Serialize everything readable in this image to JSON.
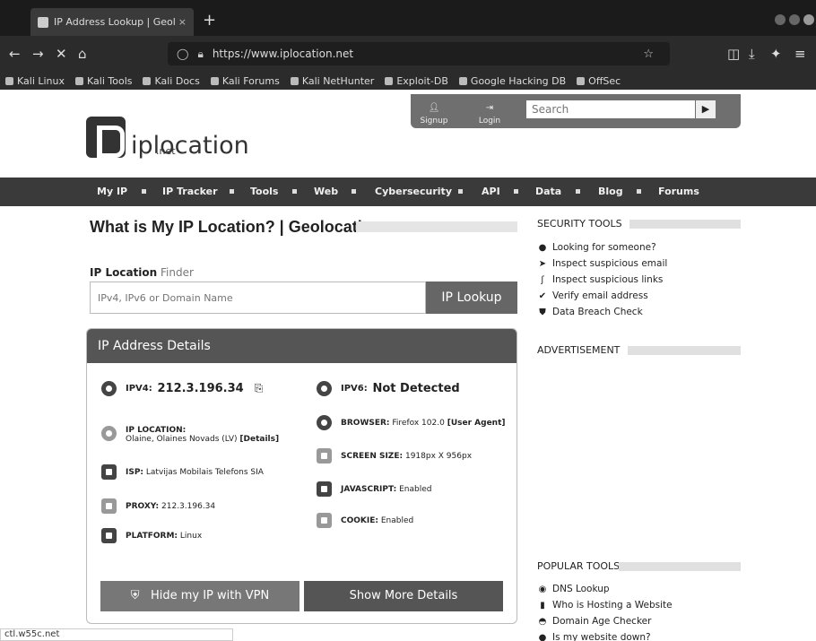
{
  "browser": {
    "tab_title": "IP Address Lookup | Geolo",
    "tab_close": "×",
    "new_tab": "+",
    "nav": {
      "back": "←",
      "forward": "→",
      "stop": "✕",
      "home": "⌂"
    },
    "url": "https://www.iplocation.net",
    "bookmarks": [
      "Kali Linux",
      "Kali Tools",
      "Kali Docs",
      "Kali Forums",
      "Kali NetHunter",
      "Exploit-DB",
      "Google Hacking DB",
      "OffSec"
    ],
    "status_url": "ctl.w55c.net"
  },
  "site": {
    "logo_text": "iplocation",
    "logo_sub": ".net",
    "signup": "Signup",
    "login": "Login",
    "search_placeholder": "Search",
    "search_btn": "▶",
    "menu": [
      "My IP",
      "IP Tracker",
      "Tools",
      "Web",
      "Cybersecurity",
      "API",
      "Data",
      "Blog",
      "Forums"
    ]
  },
  "main": {
    "title": "What is My IP Location? | Geolocation",
    "finder_bold": "IP Location",
    "finder_light": "Finder",
    "finder_placeholder": "IPv4, IPv6 or Domain Name",
    "lookup_btn": "IP Lookup",
    "card_title": "IP Address Details",
    "ipv4_label": "IPV4:",
    "ipv4_value": "212.3.196.34",
    "ipv6_label": "IPV6:",
    "ipv6_value": "Not Detected",
    "location_label": "IP LOCATION:",
    "location_value": "Olaine, Olaines Novads (LV)",
    "location_details": "[Details]",
    "browser_label": "BROWSER:",
    "browser_value": "Firefox 102.0",
    "user_agent": "[User Agent]",
    "isp_label": "ISP:",
    "isp_value": "Latvijas Mobilais Telefons SIA",
    "screen_label": "SCREEN SIZE:",
    "screen_value": "1918px X 956px",
    "javascript_label": "JAVASCRIPT:",
    "javascript_value": "Enabled",
    "proxy_label": "PROXY:",
    "proxy_value": "212.3.196.34",
    "cookie_label": "COOKIE:",
    "cookie_value": "Enabled",
    "platform_label": "PLATFORM:",
    "platform_value": "Linux",
    "vpn_btn": "Hide my IP with VPN",
    "more_btn": "Show More Details"
  },
  "sidebar": {
    "security_title": "SECURITY TOOLS",
    "security_items": [
      "Looking for someone?",
      "Inspect suspicious email",
      "Inspect suspicious links",
      "Verify email address",
      "Data Breach Check"
    ],
    "ad_title": "ADVERTISEMENT",
    "popular_title": "POPULAR TOOLS",
    "popular_items": [
      "DNS Lookup",
      "Who is Hosting a Website",
      "Domain Age Checker",
      "Is my website down?"
    ]
  }
}
